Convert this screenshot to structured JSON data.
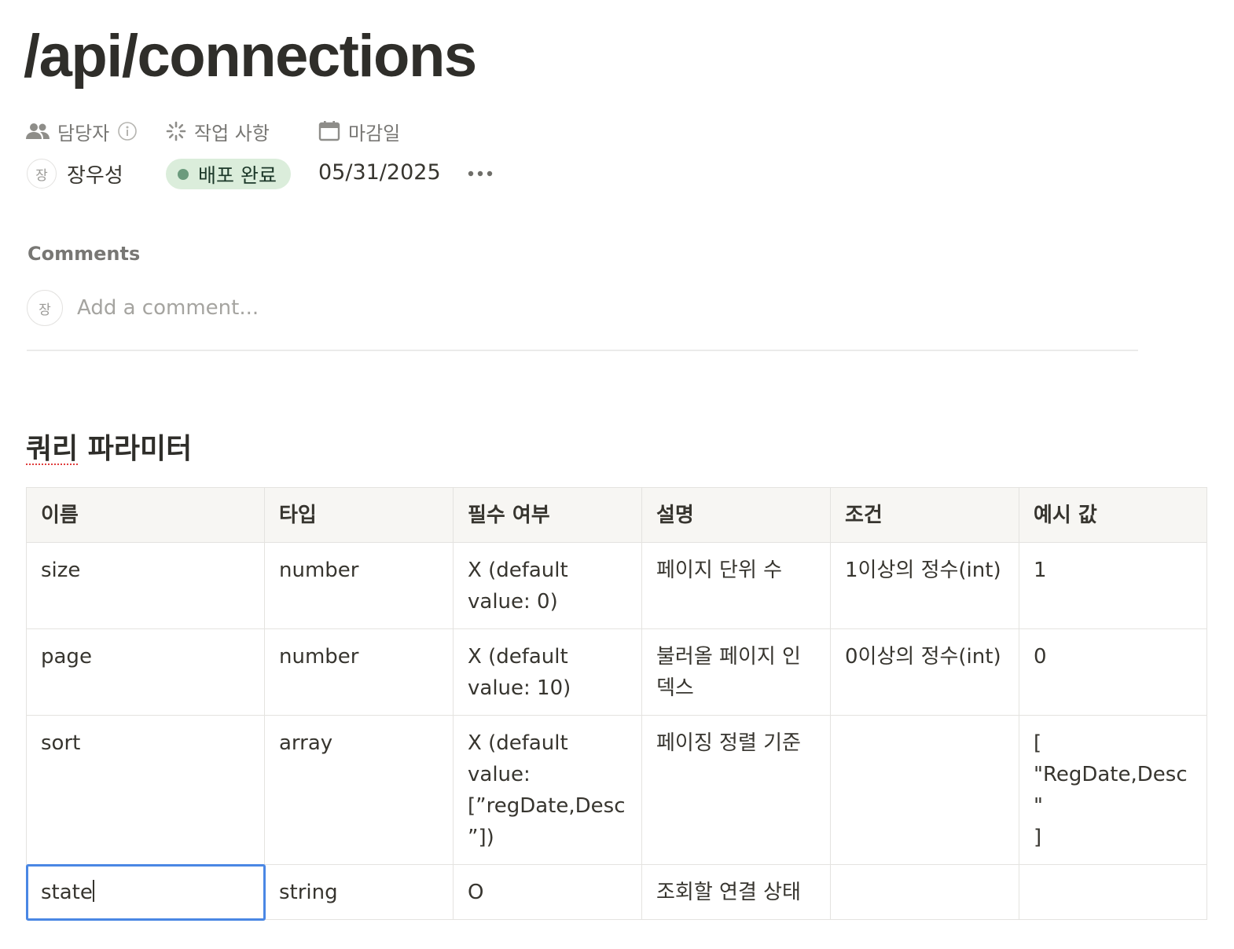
{
  "page": {
    "title": "/api/connections"
  },
  "properties": {
    "assignee_label": "담당자",
    "task_label": "작업 사항",
    "due_label": "마감일",
    "assignee_initial": "장",
    "assignee_name": "장우성",
    "status": "배포 완료",
    "status_color": "#dbeddb",
    "status_dot_color": "#6c9b7d",
    "due_date": "05/31/2025"
  },
  "comments": {
    "label": "Comments",
    "avatar_initial": "장",
    "placeholder": "Add a comment..."
  },
  "section": {
    "heading_part1": "쿼리",
    "heading_part2": " 파라미터"
  },
  "table": {
    "headers": [
      "이름",
      "타입",
      "필수 여부",
      "설명",
      "조건",
      "예시 값"
    ],
    "rows": [
      [
        "size",
        "number",
        "X (default value: 0)",
        "페이지 단위 수",
        "1이상의 정수(int)",
        "1"
      ],
      [
        "page",
        "number",
        "X (default value: 10)",
        "불러올 페이지 인덱스",
        "0이상의 정수(int)",
        "0"
      ],
      [
        "sort",
        "array",
        "X (default value: [”regDate,Desc”])",
        "페이징 정렬 기준",
        "",
        "[\n\"RegDate,Desc\"\n]"
      ],
      [
        "state",
        "string",
        "O",
        "조회할 연결 상태",
        "",
        ""
      ]
    ]
  },
  "icons": {
    "assignee": "people-icon",
    "task": "loading-spinner-icon",
    "due": "calendar-icon",
    "info": "info-icon",
    "more": "more-horizontal-icon"
  }
}
